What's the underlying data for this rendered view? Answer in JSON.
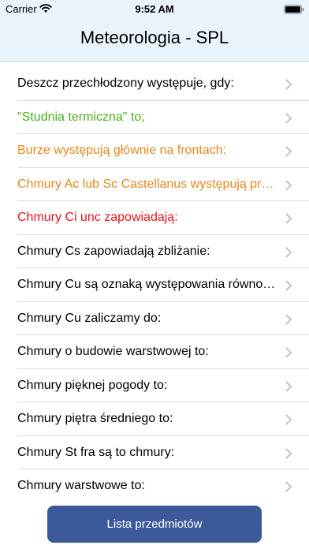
{
  "status": {
    "carrier": "Carrier",
    "time": "9:52 AM"
  },
  "header": {
    "title": "Meteorologia - SPL"
  },
  "colors": {
    "header_bg": "#e8f3fc",
    "green": "#4cae1c",
    "orange": "#e6861c",
    "red": "#e8121b",
    "black": "#000000",
    "button_bg": "#3c5a9a",
    "chevron": "#c4c4c9"
  },
  "list": {
    "items": [
      {
        "label": "Deszcz przechłodzony występuje, gdy:",
        "color": "#000000"
      },
      {
        "label": "\"Studnia termiczna\" to;",
        "color": "#4cae1c"
      },
      {
        "label": "Burze występują głównie na frontach:",
        "color": "#e6861c"
      },
      {
        "label": "Chmury Ac lub Sc Castellanus występują przed",
        "color": "#e6861c"
      },
      {
        "label": "Chmury Ci unc zapowiadają:",
        "color": "#e8121b"
      },
      {
        "label": "Chmury Cs zapowiadają zbliżanie:",
        "color": "#000000"
      },
      {
        "label": "Chmury Cu są oznaką występowania równowagi",
        "color": "#000000"
      },
      {
        "label": "Chmury Cu zaliczamy do:",
        "color": "#000000"
      },
      {
        "label": "Chmury o budowie warstwowej to:",
        "color": "#000000"
      },
      {
        "label": "Chmury pięknej pogody to:",
        "color": "#000000"
      },
      {
        "label": "Chmury piętra średniego to:",
        "color": "#000000"
      },
      {
        "label": "Chmury St fra są to chmury:",
        "color": "#000000"
      },
      {
        "label": "Chmury warstwowe to:",
        "color": "#000000"
      }
    ]
  },
  "footer": {
    "button_label": "Lista przedmiotów"
  }
}
